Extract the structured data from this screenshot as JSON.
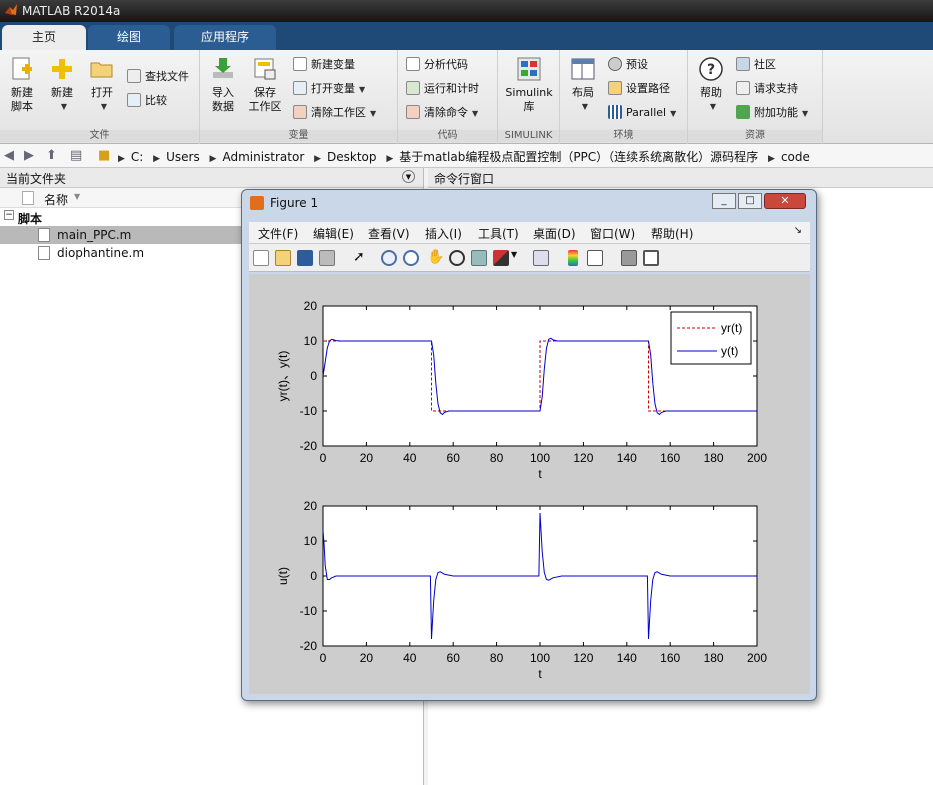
{
  "app": {
    "title": "MATLAB R2014a"
  },
  "tabs": [
    {
      "label": "主页"
    },
    {
      "label": "绘图"
    },
    {
      "label": "应用程序"
    }
  ],
  "ribbon": {
    "file": {
      "group": "文件",
      "new_script": [
        "新建",
        "脚本"
      ],
      "new": "新建",
      "open": "打开",
      "find_files": "查找文件",
      "compare": "比较"
    },
    "variable": {
      "group": "变量",
      "import": [
        "导入",
        "数据"
      ],
      "save_ws": [
        "保存",
        "工作区"
      ],
      "new_var": "新建变量",
      "open_var": "打开变量",
      "clear_ws": "清除工作区"
    },
    "code": {
      "group": "代码",
      "analyze": "分析代码",
      "run_time": "运行和计时",
      "clear_cmd": "清除命令"
    },
    "simulink": {
      "group": "SIMULINK",
      "lib": [
        "Simulink",
        "库"
      ]
    },
    "env": {
      "group": "环境",
      "layout": "布局",
      "prefs": "预设",
      "set_path": "设置路径",
      "parallel": "Parallel"
    },
    "resources": {
      "group": "资源",
      "help": "帮助",
      "community": "社区",
      "support": "请求支持",
      "addons": "附加功能"
    }
  },
  "address": {
    "parts": [
      "C:",
      "Users",
      "Administrator",
      "Desktop",
      "基于matlab编程极点配置控制（PPC）（连续系统离散化）源码程序",
      "code"
    ]
  },
  "left_pane": {
    "title": "当前文件夹",
    "col_name": "名称",
    "group": "脚本",
    "files": [
      "main_PPC.m",
      "diophantine.m"
    ]
  },
  "right_pane": {
    "title": "命令行窗口"
  },
  "figure": {
    "title": "Figure 1",
    "menu": [
      "文件(F)",
      "编辑(E)",
      "查看(V)",
      "插入(I)",
      "工具(T)",
      "桌面(D)",
      "窗口(W)",
      "帮助(H)"
    ]
  },
  "chart_data": [
    {
      "type": "line",
      "xlabel": "t",
      "ylabel": "yr(t)、y(t)",
      "xlim": [
        0,
        200
      ],
      "ylim": [
        -20,
        20
      ],
      "xticks": [
        0,
        20,
        40,
        60,
        80,
        100,
        120,
        140,
        160,
        180,
        200
      ],
      "yticks": [
        -20,
        -10,
        0,
        10,
        20
      ],
      "legend": "top-right",
      "series": [
        {
          "name": "yr(t)",
          "style": "dashed",
          "color": "#cc0000",
          "x": [
            0,
            50,
            50,
            100,
            100,
            150,
            150,
            200
          ],
          "y": [
            10,
            10,
            -10,
            -10,
            10,
            10,
            -10,
            -10
          ]
        },
        {
          "name": "y(t)",
          "style": "solid",
          "color": "#0000cc",
          "x": [
            0,
            1,
            2,
            3,
            4,
            5,
            6,
            8,
            50,
            51,
            52,
            53,
            54,
            55,
            56,
            58,
            100,
            101,
            102,
            103,
            104,
            105,
            106,
            108,
            150,
            151,
            152,
            153,
            154,
            155,
            156,
            158,
            200
          ],
          "y": [
            0,
            4,
            8,
            10,
            10.5,
            10.3,
            10.1,
            10,
            10,
            6,
            -2,
            -8,
            -10.5,
            -11,
            -10.4,
            -10,
            -10,
            -6,
            2,
            8,
            10.5,
            10.8,
            10.3,
            10,
            10,
            6,
            -2,
            -8,
            -10.5,
            -11,
            -10.4,
            -10,
            -10
          ]
        }
      ]
    },
    {
      "type": "line",
      "xlabel": "t",
      "ylabel": "u(t)",
      "xlim": [
        0,
        200
      ],
      "ylim": [
        -20,
        20
      ],
      "xticks": [
        0,
        20,
        40,
        60,
        80,
        100,
        120,
        140,
        160,
        180,
        200
      ],
      "yticks": [
        -20,
        -10,
        0,
        10,
        20
      ],
      "series": [
        {
          "color": "#0000cc",
          "x": [
            0,
            0.5,
            1,
            2,
            3,
            4,
            6,
            10,
            49.5,
            50,
            51,
            52,
            53,
            54,
            56,
            60,
            99.5,
            100,
            101,
            102,
            103,
            104,
            106,
            110,
            149.5,
            150,
            151,
            152,
            153,
            154,
            156,
            160,
            200
          ],
          "y": [
            13,
            9,
            3,
            -1,
            -1,
            -0.5,
            0,
            0,
            0,
            -18,
            -7,
            -1,
            1,
            1.2,
            0.5,
            0,
            0,
            18,
            7,
            1,
            -1,
            -1.2,
            -0.5,
            0,
            0,
            -18,
            -7,
            -1,
            1,
            1.2,
            0.5,
            0,
            0
          ]
        }
      ]
    }
  ]
}
